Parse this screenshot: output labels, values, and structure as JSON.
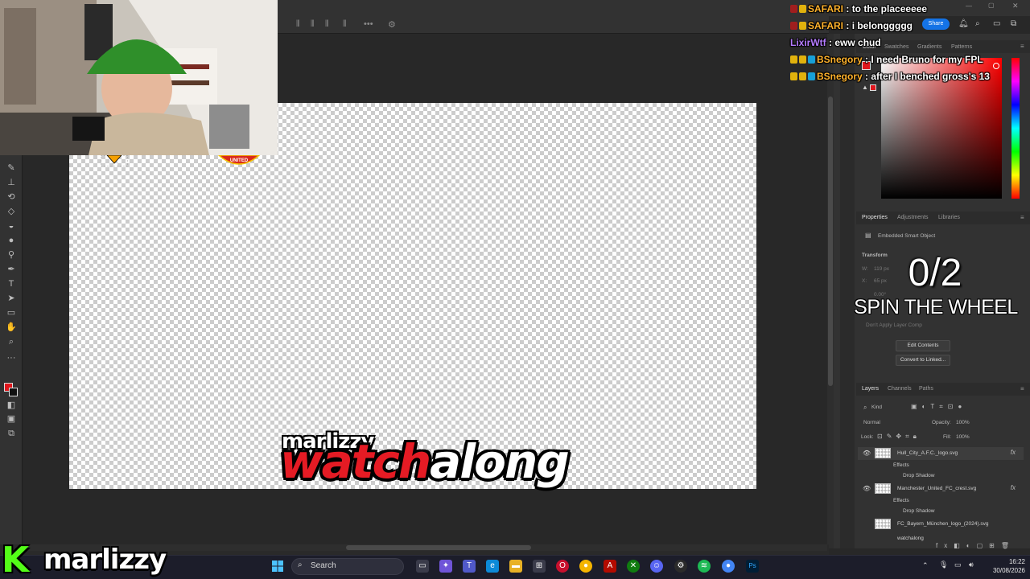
{
  "app": {
    "name": "Photoshop",
    "share_label": "Share"
  },
  "chat": [
    {
      "user": "SAFARI",
      "user_color": "#ffb22c",
      "message": "to the placeeeee"
    },
    {
      "user": "SAFARI",
      "user_color": "#ffb22c",
      "message": "i belonggggg"
    },
    {
      "user": "LixirWtf",
      "user_color": "#b57cff",
      "message": "eww chud"
    },
    {
      "user": "BSnegory",
      "user_color": "#ffb22c",
      "message": "I need Bruno for my FPL"
    },
    {
      "user": "BSnegory",
      "user_color": "#ffb22c",
      "message": "after I benched gross's 13"
    }
  ],
  "color_panel": {
    "tabs": [
      "Color",
      "Swatches",
      "Gradients",
      "Patterns"
    ],
    "foreground": "#e0161c",
    "background": "#111111"
  },
  "properties_panel": {
    "tabs": [
      "Properties",
      "Adjustments",
      "Libraries"
    ],
    "object_type": "Embedded Smart Object",
    "transform_label": "Transform",
    "w_label": "W:",
    "w_value": "119 px",
    "x_label": "X:",
    "x_value": "65 px",
    "angle_value": "0.00°",
    "layer_comp": "Don't Apply Layer Comp",
    "edit_contents": "Edit Contents",
    "convert_linked": "Convert to Linked..."
  },
  "layers_panel": {
    "tabs": [
      "Layers",
      "Channels",
      "Paths"
    ],
    "filter": "Kind",
    "blend_mode": "Normal",
    "opacity_label": "Opacity:",
    "opacity_value": "100%",
    "lock_label": "Lock:",
    "fill_label": "Fill:",
    "fill_value": "100%",
    "layers": [
      {
        "name": "Hull_City_A.F.C._logo.svg",
        "effects": "Effects",
        "effect": "Drop Shadow"
      },
      {
        "name": "Manchester_United_FC_crest.svg",
        "effects": "Effects",
        "effect": "Drop Shadow"
      },
      {
        "name": "FC_Bayern_München_logo_(2024).svg"
      },
      {
        "name": "watchalong"
      }
    ]
  },
  "canvas": {
    "logo_small": "marlizzy",
    "logo_red": "watch",
    "logo_white": "along",
    "crest_text": "UNITED"
  },
  "overlay": {
    "counter": "0/2",
    "spin": "SPIN THE WHEEL",
    "brand": "marlizzy",
    "kick_letter": "K",
    "kick_green": "#53fc18"
  },
  "taskbar": {
    "search_label": "Search",
    "time": "16:22",
    "date": "30/08/2026"
  }
}
